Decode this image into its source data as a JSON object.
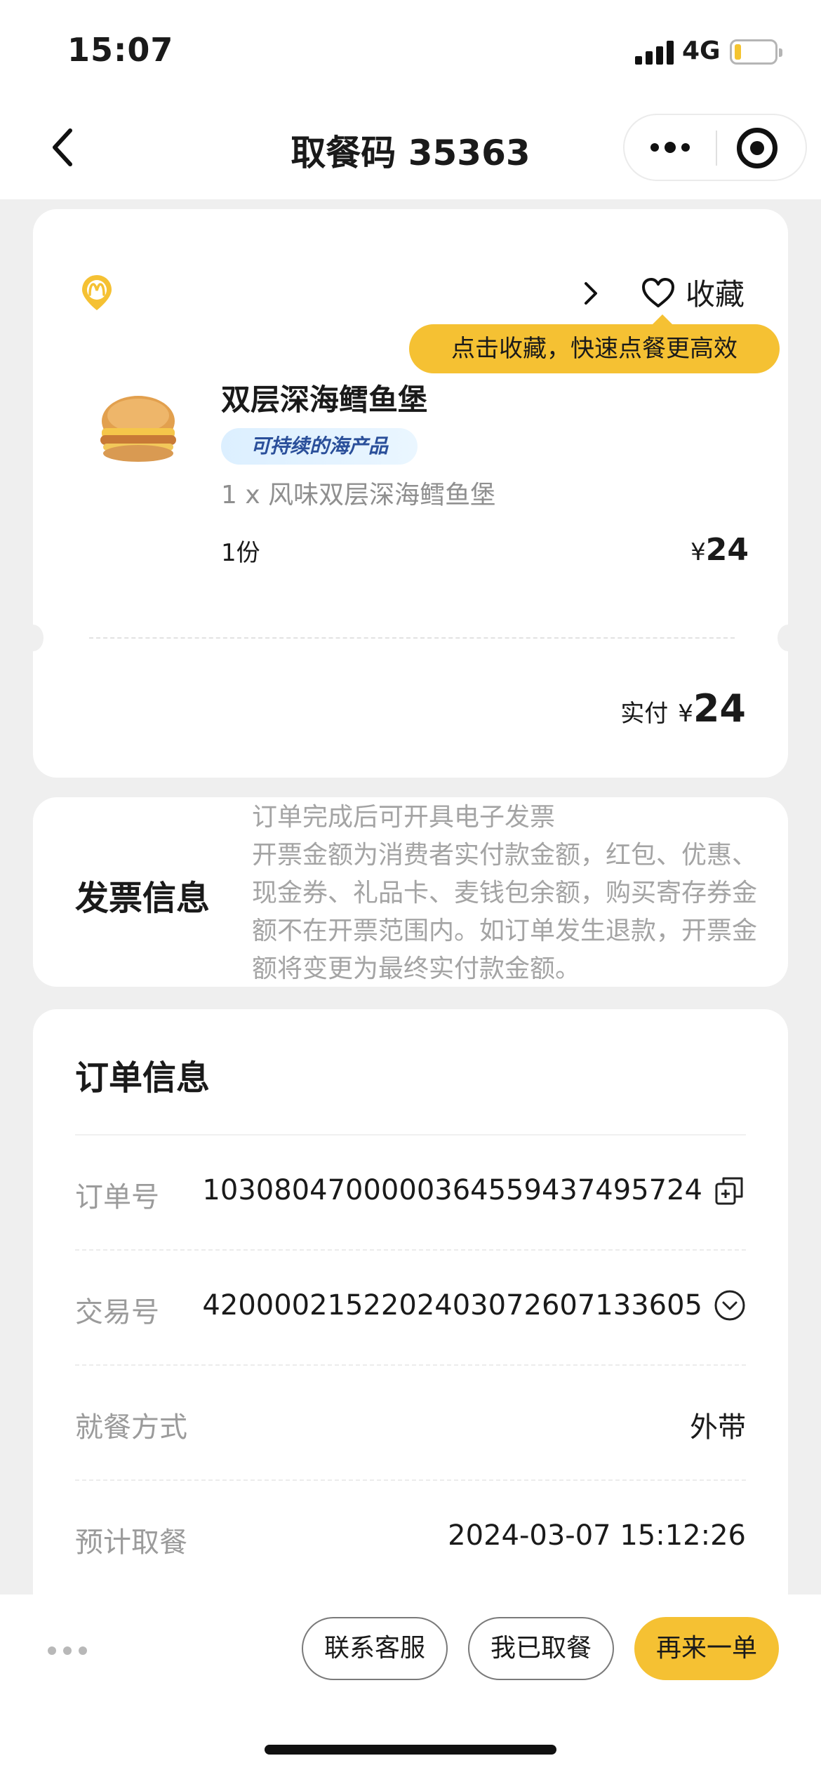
{
  "status_bar": {
    "time": "15:07",
    "network": "4G"
  },
  "nav": {
    "title": "取餐码 35363"
  },
  "order": {
    "favorite_label": "收藏",
    "favorite_tip": "点击收藏，快速点餐更高效",
    "item_name": "双层深海鳕鱼堡",
    "eco_tag": "可持续的海产品",
    "item_desc": "1 x 风味双层深海鳕鱼堡",
    "item_qty": "1份",
    "currency": "¥",
    "item_price": "24",
    "total_label": "实付",
    "total_amount": "24"
  },
  "invoice": {
    "title": "发票信息",
    "text": "订单完成后可开具电子发票\n开票金额为消费者实付款金额，红包、优惠、现金券、礼品卡、麦钱包余额，购买寄存券金额不在开票范围内。如订单发生退款，开票金额将变更为最终实付款金额。"
  },
  "info": {
    "title": "订单信息",
    "rows": [
      {
        "label": "订单号",
        "value": "1030804700000364559437495724",
        "icon": "copy-icon"
      },
      {
        "label": "交易号",
        "value": "4200002152202403072607133605",
        "icon": "expand-icon"
      },
      {
        "label": "就餐方式",
        "value": "外带"
      },
      {
        "label": "预计取餐",
        "value": "2024-03-07 15:12:26"
      }
    ]
  },
  "bottom": {
    "contact_label": "联系客服",
    "picked_label": "我已取餐",
    "reorder_label": "再来一单"
  },
  "colors": {
    "accent": "#f5c133",
    "background": "#efefef",
    "muted_text": "#9b9b9b"
  }
}
